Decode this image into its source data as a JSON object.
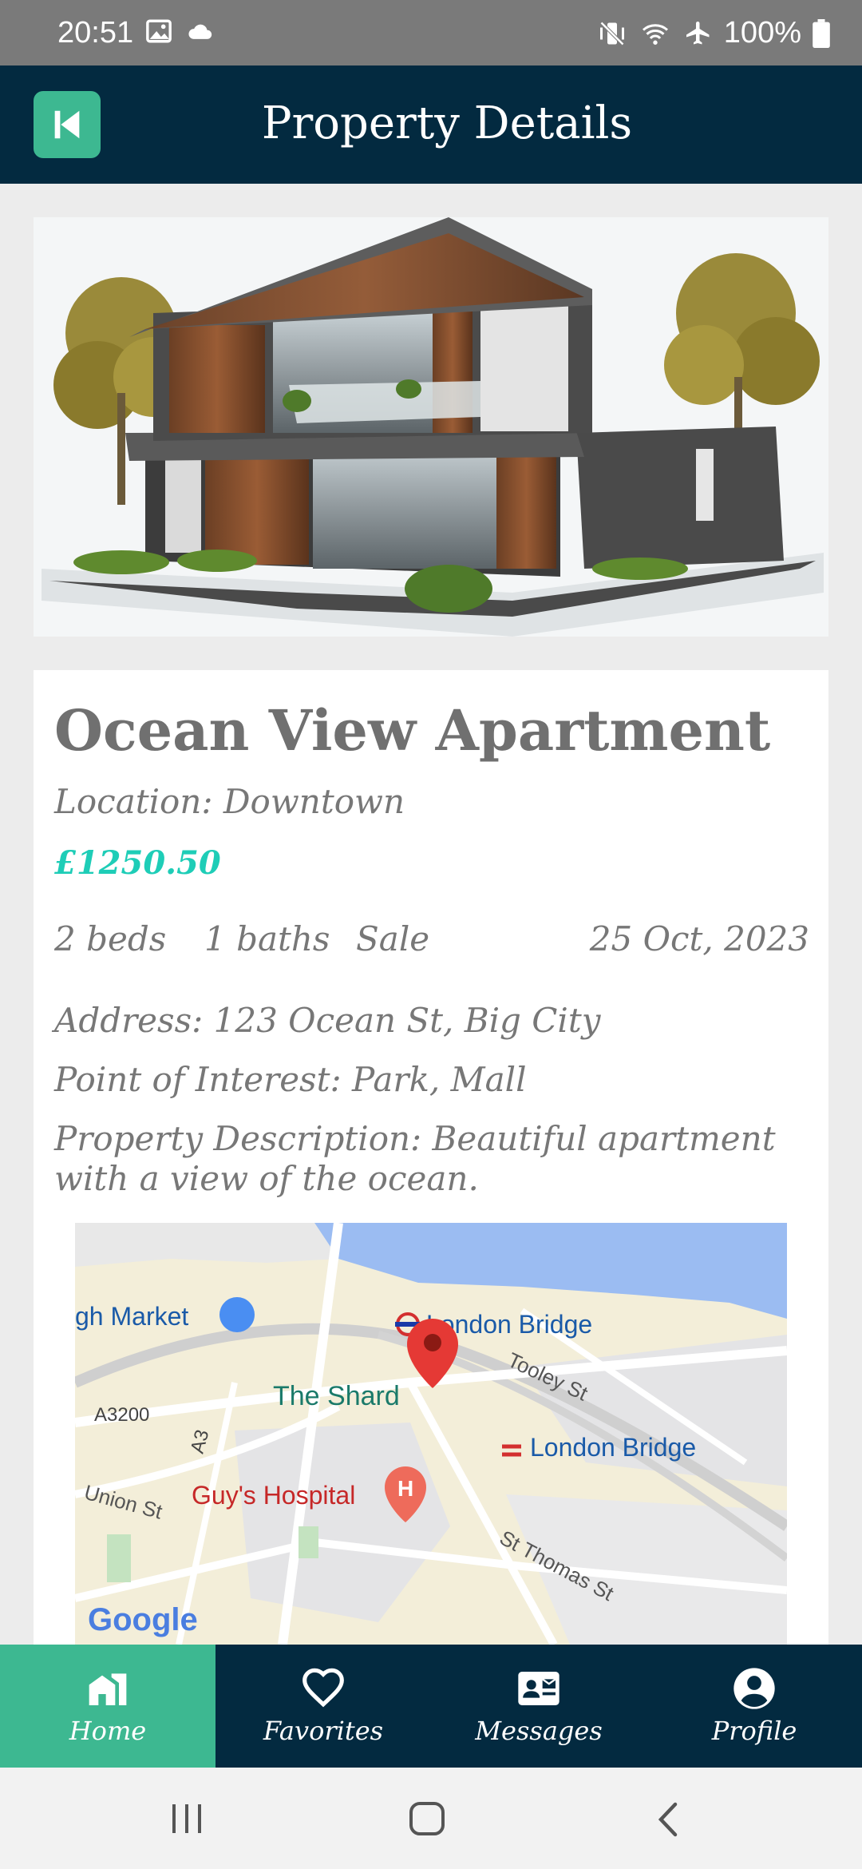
{
  "status_bar": {
    "time": "20:51",
    "battery": "100%"
  },
  "app_bar": {
    "title": "Property Details",
    "back_icon": "skip-back-icon"
  },
  "property": {
    "title": "Ocean View Apartment",
    "location": "Location: Downtown",
    "price": "£1250.50",
    "beds": "2 beds",
    "baths": "1 baths",
    "type": "Sale",
    "date": "25 Oct, 2023",
    "address": "Address: 123 Ocean St, Big City",
    "poi": "Point of Interest: Park, Mall",
    "description": "Property Description: Beautiful apartment with a view of the ocean."
  },
  "map": {
    "labels": {
      "market": "gh Market",
      "london_bridge_tube": "London Bridge",
      "tooley": "Tooley St",
      "shard": "The Shard",
      "a3200": "A3200",
      "london_bridge_rail": "London Bridge",
      "a3": "A3",
      "union": "Union St",
      "hospital": "Guy's Hospital",
      "st_thomas": "St Thomas St",
      "google": "Google"
    }
  },
  "bottom_nav": {
    "items": [
      {
        "label": "Home",
        "icon": "home-icon"
      },
      {
        "label": "Favorites",
        "icon": "heart-icon"
      },
      {
        "label": "Messages",
        "icon": "contact-card-icon"
      },
      {
        "label": "Profile",
        "icon": "account-circle-icon"
      }
    ]
  },
  "colors": {
    "primary": "#032a40",
    "accent": "#3db891",
    "price": "#1ecdb7"
  }
}
